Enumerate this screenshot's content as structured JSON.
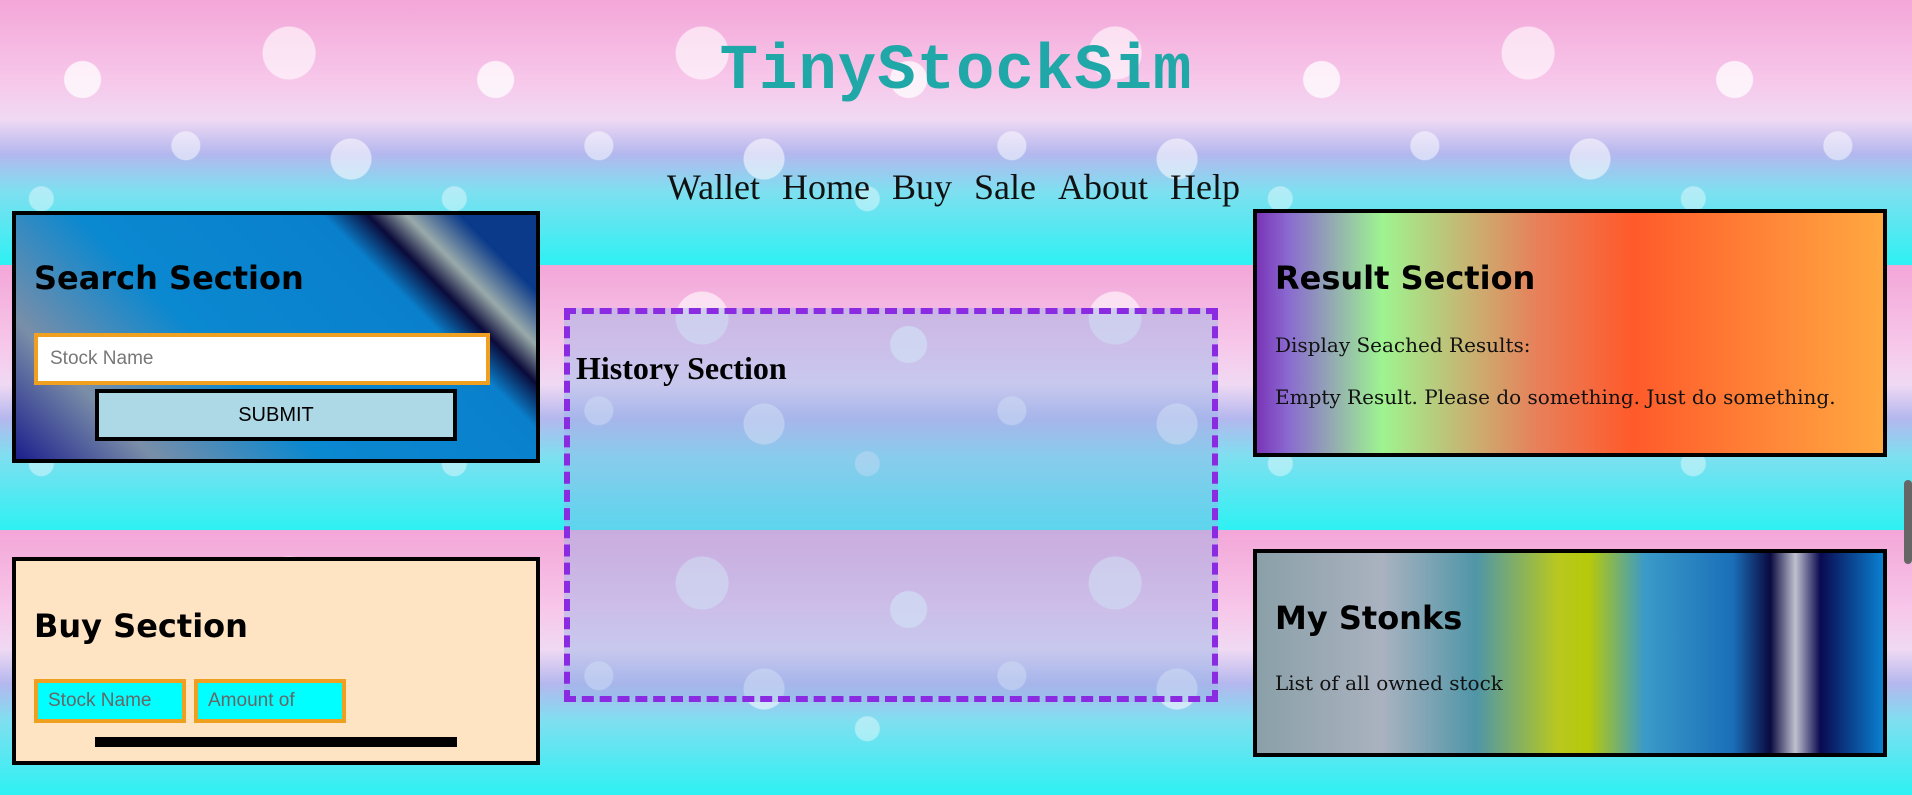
{
  "app": {
    "title": "TinyStockSim"
  },
  "nav": {
    "items": [
      "Wallet",
      "Home",
      "Buy",
      "Sale",
      "About",
      "Help"
    ]
  },
  "search": {
    "title": "Search Section",
    "input_placeholder": "Stock Name",
    "submit_label": "SUBMIT"
  },
  "history": {
    "title": "History Section"
  },
  "result": {
    "title": "Result Section",
    "label": "Display Seached Results:",
    "message": "Empty Result. Please do something. Just do something."
  },
  "buy": {
    "title": "Buy Section",
    "stock_placeholder": "Stock Name",
    "amount_placeholder": "Amount of"
  },
  "stonks": {
    "title": "My Stonks",
    "description": "List of all owned stock"
  },
  "colors": {
    "title": "#20a8a8",
    "history_border": "#8a2be2",
    "input_border": "#f0a020",
    "submit_bg": "#add8e6",
    "buy_bg": "#ffe4c4",
    "buy_input_bg": "#00ffff"
  }
}
